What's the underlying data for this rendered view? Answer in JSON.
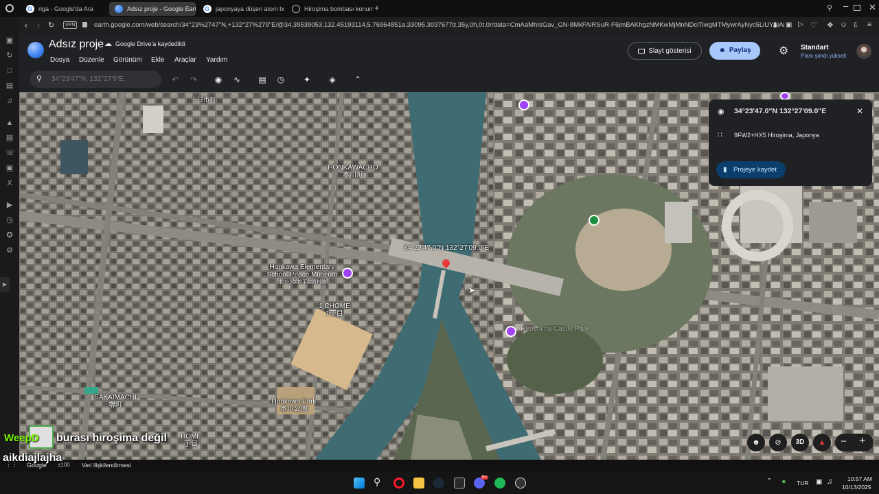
{
  "browser": {
    "tabs": [
      {
        "label": "riga - Google'da Ara",
        "icon": "google-icon"
      },
      {
        "label": "Adsız proje - Google Earth",
        "icon": "google-earth-icon"
      },
      {
        "label": "japonyaya düşen atom bo…",
        "icon": "google-icon"
      },
      {
        "label": "Hiroşima bombası konum…",
        "icon": "globe-icon"
      }
    ],
    "new_tab": "+",
    "vpn": "VPN",
    "url": "earth.google.com/web/search/34°23%2747\"N,+132°27%279\"E/@34.39539053,132.45193114,5.76964851a,33095.3037677d,35y,0h,0t,0r/data=CmAaMhIsGav_GN-8MkFAlRSuR-F6jmBAKhgzNMKwMjMnNDciTiwgMTMywrAyNyc5LiUYAiAi"
  },
  "earth": {
    "project_name": "Adsız proje",
    "drive_status": "Google Drive'a kaydedildi",
    "menu": [
      "Dosya",
      "Düzenle",
      "Görünüm",
      "Ekle",
      "Araçlar",
      "Yardım"
    ],
    "slideshow_label": "Slayt gösterisi",
    "share_label": "Paylaş",
    "plan_title": "Standart",
    "plan_upgrade": "Planı şimdi yükselt",
    "search_placeholder": "34°23'47\"N, 132°27'9\"E."
  },
  "info_card": {
    "coordinates": "34°23'47.0\"N 132°27'09.0\"E",
    "plus_code": "9FW2+HX5 Hiroşima, Japonya",
    "save_label": "Projeye kaydet"
  },
  "map": {
    "labels": [
      {
        "en": "HONKAWACHO",
        "jp": "本川町"
      },
      {
        "en": "Honkawa Elementary School Peace Museum",
        "jp": "本川小学校平和資料館"
      },
      {
        "en": "1 CHOME",
        "jp": "1丁目"
      },
      {
        "en": "SAKAIMACHI",
        "jp": "堺町"
      },
      {
        "en": "Honkawa Park",
        "jp": "本川公園"
      },
      {
        "en": "HOME",
        "jp": "丁目"
      },
      {
        "en": "Hiroshima Castle Park",
        "jp": ""
      }
    ],
    "pin_label": "34°23'47.0\"N 132°27'09.0\"E",
    "top_left_jp": "十日市町",
    "view_3d": "3D",
    "google_mark": "Google",
    "scale": "±100",
    "data_attribution": "Veri ilişkilendirmesi"
  },
  "overlay": {
    "channel": "WeepD",
    "message": "burası hiroşima değil",
    "user": "aikdiajlajha"
  },
  "taskbar": {
    "lang": "TUR",
    "time": "10:57 AM",
    "date": "10/13/2025",
    "discord_badge": "9+"
  },
  "colors": {
    "accent_share": "#a8c7fa",
    "pin": "#e53935",
    "water": "#3f6b72",
    "panel": "#202124"
  }
}
